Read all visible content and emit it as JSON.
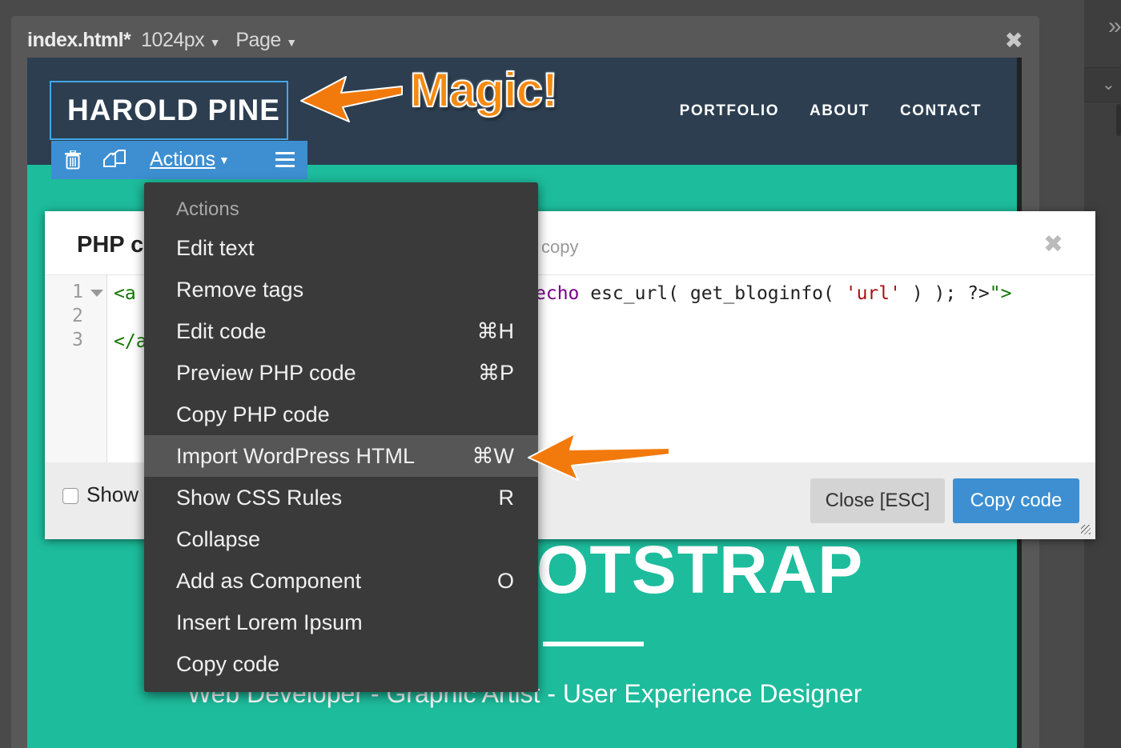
{
  "window": {
    "filename": "index.html",
    "modified_mark": "*",
    "width_selector": "1024px",
    "view_selector": "Page"
  },
  "site": {
    "brand": "HAROLD PINE",
    "nav": [
      "PORTFOLIO",
      "ABOUT",
      "CONTACT"
    ],
    "hero_title": "OTSTRAP",
    "hero_subtitle": "Web Developer - Graphic Artist - User Experience Designer"
  },
  "toolbar": {
    "actions_label": "Actions"
  },
  "dialog": {
    "title": "PHP c",
    "hint": "copy",
    "line_numbers": [
      "1",
      "2",
      "3"
    ],
    "code_line1_start": "<a",
    "code_line1_end_kw": "echo",
    "code_line1_end_fn": " esc_url( get_bloginfo( ",
    "code_line1_end_str": "'url'",
    "code_line1_end_tail": " ) ); ?>",
    "code_line1_end_close": "\">",
    "code_line3_start": "</a",
    "show_label": "Show",
    "close_button": "Close [ESC]",
    "copy_button": "Copy code"
  },
  "context_menu": {
    "header": "Actions",
    "items": [
      {
        "label": "Edit text",
        "shortcut": ""
      },
      {
        "label": "Remove tags",
        "shortcut": ""
      },
      {
        "label": "Edit code",
        "shortcut": "⌘H"
      },
      {
        "label": "Preview PHP code",
        "shortcut": "⌘P"
      },
      {
        "label": "Copy PHP code",
        "shortcut": ""
      },
      {
        "label": "Import WordPress HTML",
        "shortcut": "⌘W"
      },
      {
        "label": "Show CSS Rules",
        "shortcut": "R"
      },
      {
        "label": "Collapse",
        "shortcut": ""
      },
      {
        "label": "Add as Component",
        "shortcut": "O"
      },
      {
        "label": "Insert Lorem Ipsum",
        "shortcut": ""
      },
      {
        "label": "Copy code",
        "shortcut": ""
      }
    ],
    "highlighted_index": 5
  },
  "annotation": {
    "magic_text": "Magic!",
    "arrow_color": "#f27a0c"
  },
  "colors": {
    "navbar": "#2c3e50",
    "hero": "#1dbc9c",
    "accent_blue": "#3d8fd1",
    "menu_bg": "#3a3a3a"
  }
}
